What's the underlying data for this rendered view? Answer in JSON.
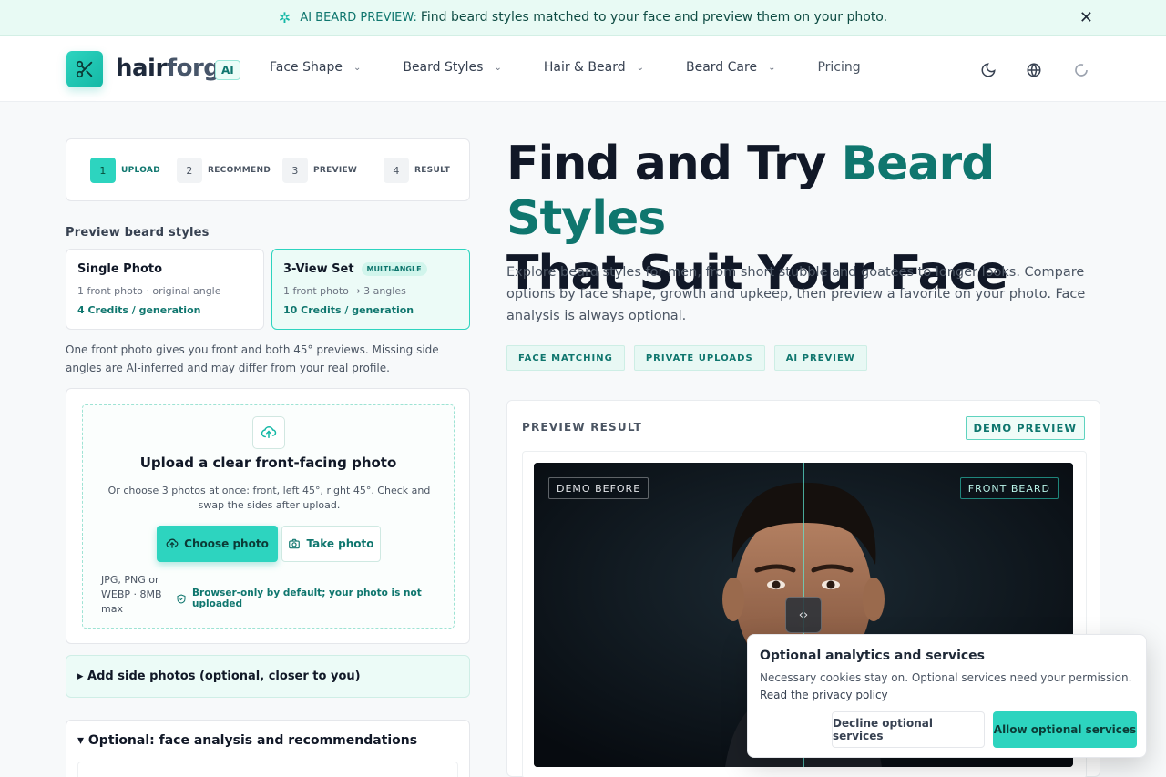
{
  "announcement": {
    "label": "AI BEARD PREVIEW:",
    "text": "Find beard styles matched to your face and preview them on your photo.",
    "icon": "sparkle-icon",
    "close_icon": "close-icon"
  },
  "header": {
    "brand_part1": "hair",
    "brand_part2": "forge",
    "badge": "AI",
    "nav": [
      {
        "label": "Face Shape",
        "has_dropdown": true
      },
      {
        "label": "Beard Styles",
        "has_dropdown": true
      },
      {
        "label": "Hair & Beard",
        "has_dropdown": true
      },
      {
        "label": "Beard Care",
        "has_dropdown": true
      },
      {
        "label": "Pricing",
        "has_dropdown": false
      }
    ],
    "icons": [
      "moon-icon",
      "globe-icon",
      "loading-icon"
    ]
  },
  "stepper": {
    "steps": [
      {
        "num": "1",
        "label": "UPLOAD",
        "active": true
      },
      {
        "num": "2",
        "label": "RECOMMEND",
        "active": false
      },
      {
        "num": "3",
        "label": "PREVIEW",
        "active": false
      },
      {
        "num": "4",
        "label": "RESULT",
        "active": false
      }
    ]
  },
  "options": {
    "title": "Preview beard styles",
    "single": {
      "title": "Single Photo",
      "sub": "1 front photo · original angle",
      "credits": "4 Credits / generation"
    },
    "multi": {
      "title": "3-View Set",
      "badge": "MULTI-ANGLE",
      "sub": "1 front photo → 3 angles",
      "credits": "10 Credits / generation",
      "selected": true
    },
    "note": "One front photo gives you front and both 45° previews. Missing side angles are AI-inferred and may differ from your real profile."
  },
  "upload": {
    "title": "Upload a clear front-facing photo",
    "desc": "Or choose 3 photos at once: front, left 45°, right 45°. Check and swap the sides after upload.",
    "choose": "Choose photo",
    "take": "Take photo",
    "formats": "JPG, PNG or WEBP · 8MB max",
    "privacy": "Browser-only by default; your photo is not uploaded"
  },
  "accordions": {
    "side": "▸ Add side photos (optional, closer to you)",
    "face": "▾ Optional: face analysis and recommendations"
  },
  "hero": {
    "title_line1_a": "Find and Try ",
    "title_line1_b": "Beard Styles",
    "title_line2": "That Suit Your Face",
    "desc": "Explore beard styles for men, from short stubble and goatees to longer looks. Compare options by face shape, growth and upkeep, then preview a favorite on your photo. Face analysis is always optional.",
    "tags": [
      "FACE  MATCHING",
      "PRIVATE  UPLOADS",
      "AI  PREVIEW"
    ]
  },
  "preview": {
    "title": "PREVIEW RESULT",
    "badge": "DEMO PREVIEW",
    "left_label": "DEMO BEFORE",
    "right_label": "FRONT BEARD",
    "handle": "‹›"
  },
  "cookie": {
    "title": "Optional analytics and services",
    "desc": "Necessary cookies stay on. Optional services need your permission.",
    "link": "Read the privacy policy",
    "decline": "Decline optional services",
    "allow": "Allow optional services"
  }
}
